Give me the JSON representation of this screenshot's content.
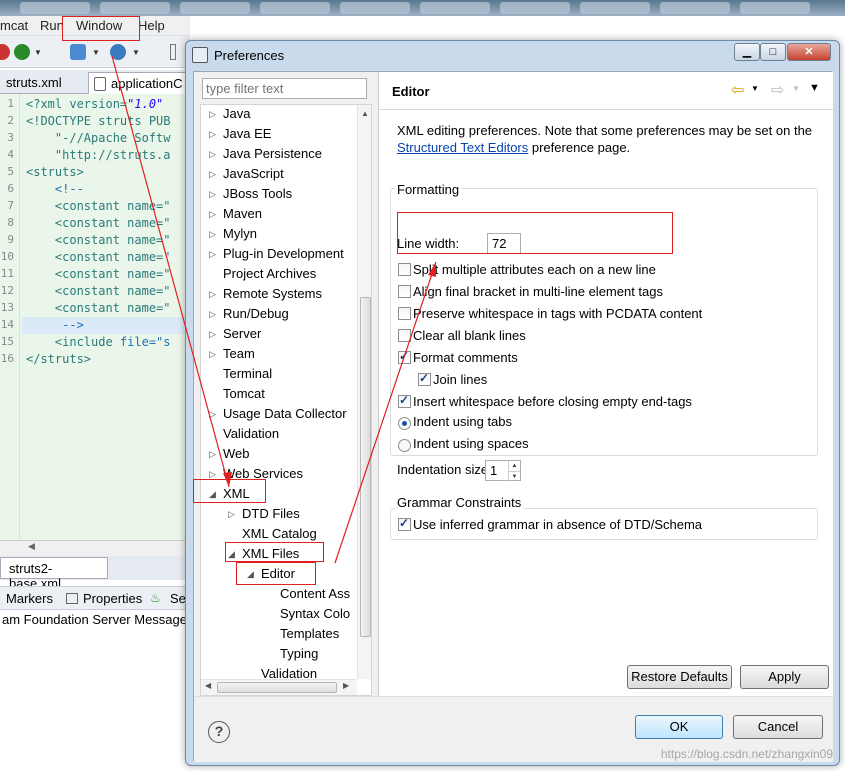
{
  "background": {
    "menu": [
      "mcat",
      "Run",
      "Window",
      "Help"
    ],
    "tabs": [
      "struts.xml",
      "applicationC"
    ],
    "lines": [
      "1",
      "2",
      "3",
      "4",
      "5",
      "6",
      "7",
      "8",
      "9",
      "10",
      "11",
      "12",
      "13",
      "14",
      "15",
      "16"
    ],
    "code": {
      "l1a": "<?xml version=",
      "l1b": "\"1.0\"",
      "l2": "<!DOCTYPE struts PUB",
      "l3": "    \"-//Apache Softw",
      "l4": "    \"http://struts.a",
      "l5": "<struts>",
      "l6": "    <!--",
      "l7": "    <constant name=\"",
      "l14": "     -->",
      "l15a": "    <include ",
      "l15b": "file=\"s",
      "l16": "</struts>"
    },
    "bottom_tab": "struts2-base.xml",
    "views": [
      "Markers",
      "Properties",
      "Se"
    ],
    "console": "am Foundation Server Message"
  },
  "dialog": {
    "title": "Preferences",
    "filter_placeholder": "type filter text",
    "tree": [
      {
        "label": "Java",
        "expander": "▷"
      },
      {
        "label": "Java EE",
        "expander": "▷"
      },
      {
        "label": "Java Persistence",
        "expander": "▷"
      },
      {
        "label": "JavaScript",
        "expander": "▷"
      },
      {
        "label": "JBoss Tools",
        "expander": "▷"
      },
      {
        "label": "Maven",
        "expander": "▷"
      },
      {
        "label": "Mylyn",
        "expander": "▷"
      },
      {
        "label": "Plug-in Development",
        "expander": "▷"
      },
      {
        "label": "Project Archives",
        "expander": ""
      },
      {
        "label": "Remote Systems",
        "expander": "▷"
      },
      {
        "label": "Run/Debug",
        "expander": "▷"
      },
      {
        "label": "Server",
        "expander": "▷"
      },
      {
        "label": "Team",
        "expander": "▷"
      },
      {
        "label": "Terminal",
        "expander": ""
      },
      {
        "label": "Tomcat",
        "expander": ""
      },
      {
        "label": "Usage Data Collector",
        "expander": "▷"
      },
      {
        "label": "Validation",
        "expander": ""
      },
      {
        "label": "Web",
        "expander": "▷"
      },
      {
        "label": "Web Services",
        "expander": "▷"
      },
      {
        "label": "XML",
        "expander": "◢"
      },
      {
        "label": "DTD Files",
        "expander": "▷"
      },
      {
        "label": "XML Catalog",
        "expander": ""
      },
      {
        "label": "XML Files",
        "expander": "◢"
      },
      {
        "label": "Editor",
        "expander": "◢"
      },
      {
        "label": "Content Ass",
        "expander": ""
      },
      {
        "label": "Syntax Colo",
        "expander": ""
      },
      {
        "label": "Templates",
        "expander": ""
      },
      {
        "label": "Typing",
        "expander": ""
      },
      {
        "label": "Validation",
        "expander": ""
      }
    ],
    "page": {
      "title": "Editor",
      "desc1": "XML editing preferences.  Note that some preferences may be set on the",
      "link": "Structured Text Editors",
      "desc2": " preference page.",
      "formatting": {
        "title": "Formatting",
        "line_width_label": "Line width:",
        "line_width_value": "72",
        "options": [
          {
            "label": "Split multiple attributes each on a new line",
            "checked": false
          },
          {
            "label": "Align final bracket in multi-line element tags",
            "checked": false
          },
          {
            "label": "Preserve whitespace in tags with PCDATA content",
            "checked": false
          },
          {
            "label": "Clear all blank lines",
            "checked": false
          },
          {
            "label": "Format comments",
            "checked": true
          },
          {
            "label": "Join lines",
            "checked": true
          },
          {
            "label": "Insert whitespace before closing empty end-tags",
            "checked": true
          }
        ],
        "radio_tabs": "Indent using tabs",
        "radio_spaces": "Indent using spaces",
        "indent_selected": "tabs",
        "indent_size_label": "Indentation size:",
        "indent_size_value": "1"
      },
      "grammar": {
        "title": "Grammar Constraints",
        "option": "Use inferred grammar in absence of DTD/Schema",
        "checked": true
      }
    },
    "buttons": {
      "restore": "Restore Defaults",
      "apply": "Apply",
      "ok": "OK",
      "cancel": "Cancel",
      "help": "?"
    }
  },
  "watermark": "https://blog.csdn.net/zhangxin09"
}
